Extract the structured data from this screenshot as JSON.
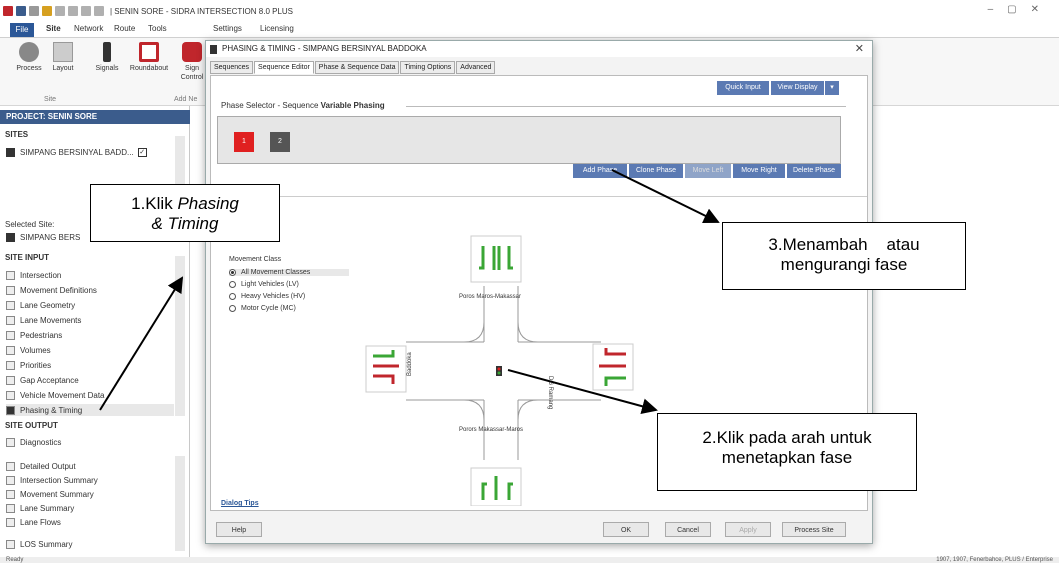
{
  "app": {
    "title": "| SENIN SORE - SIDRA INTERSECTION 8.0 PLUS",
    "tabs": [
      "File",
      "Site",
      "Network",
      "Route",
      "Tools",
      "Settings",
      "Licensing"
    ],
    "ribbon_buttons": [
      "Process",
      "Layout",
      "Signals",
      "Roundabout",
      "Sign Control"
    ],
    "group_site": "Site",
    "group_add": "Add Ne"
  },
  "project": {
    "header": "PROJECT: SENIN SORE",
    "sites_label": "SITES",
    "site_name": "SIMPANG BERSINYAL BADD...",
    "selected_label": "Selected Site:",
    "selected_name": "SIMPANG BERS",
    "site_input_label": "SITE INPUT",
    "site_input": [
      "Intersection",
      "Movement Definitions",
      "Lane Geometry",
      "Lane Movements",
      "Pedestrians",
      "Volumes",
      "Priorities",
      "Gap Acceptance",
      "Vehicle Movement Data",
      "Phasing & Timing"
    ],
    "site_output_label": "SITE OUTPUT",
    "site_output": [
      "Diagnostics",
      "Detailed Output",
      "Intersection Summary",
      "Movement Summary",
      "Lane Summary",
      "Lane Flows",
      "LOS Summary"
    ]
  },
  "status": {
    "left": "Ready",
    "right": "1907, 1907, Fenerbahce, PLUS / Enterprise"
  },
  "dialog": {
    "title": "PHASING & TIMING - SIMPANG BERSINYAL BADDOKA",
    "tabs": [
      "Sequences",
      "Sequence Editor",
      "Phase & Sequence Data",
      "Timing Options",
      "Advanced"
    ],
    "quick_input": "Quick Input",
    "view_display": "View Display",
    "phase_selector_label": "Phase Selector - Sequence",
    "sequence_name": "Variable Phasing",
    "phases": [
      "1",
      "2"
    ],
    "phase_buttons": [
      "Add Phase",
      "Clone Phase",
      "Move Left",
      "Move Right",
      "Delete Phase"
    ],
    "movement_class_label": "Movement Class",
    "movement_classes": [
      "All Movement Classes",
      "Light Vehicles (LV)",
      "Heavy Vehicles (HV)",
      "Motor Cycle (MC)"
    ],
    "road_north": "Poros Maros-Makassar",
    "road_south": "Porors Makassar-Maros",
    "road_west": "Baddoka",
    "road_east": "DG Ramang",
    "dialog_tips": "Dialog Tips",
    "footer_buttons": [
      "Help",
      "OK",
      "Cancel",
      "Apply",
      "Process Site"
    ]
  },
  "callouts": {
    "c1_a": "1.Klik",
    "c1_b": "Phasing",
    "c1_c": "& Timing",
    "c2_a": "2.Klik pada arah untuk",
    "c2_b": "menetapkan fase",
    "c3_a": "3.Menambah    atau",
    "c3_b": "mengurangi fase"
  },
  "colors": {
    "accent_blue": "#3b5c8c",
    "phase_red": "#e02020",
    "arrow_green": "#3aa635",
    "arrow_red": "#c0262c"
  }
}
